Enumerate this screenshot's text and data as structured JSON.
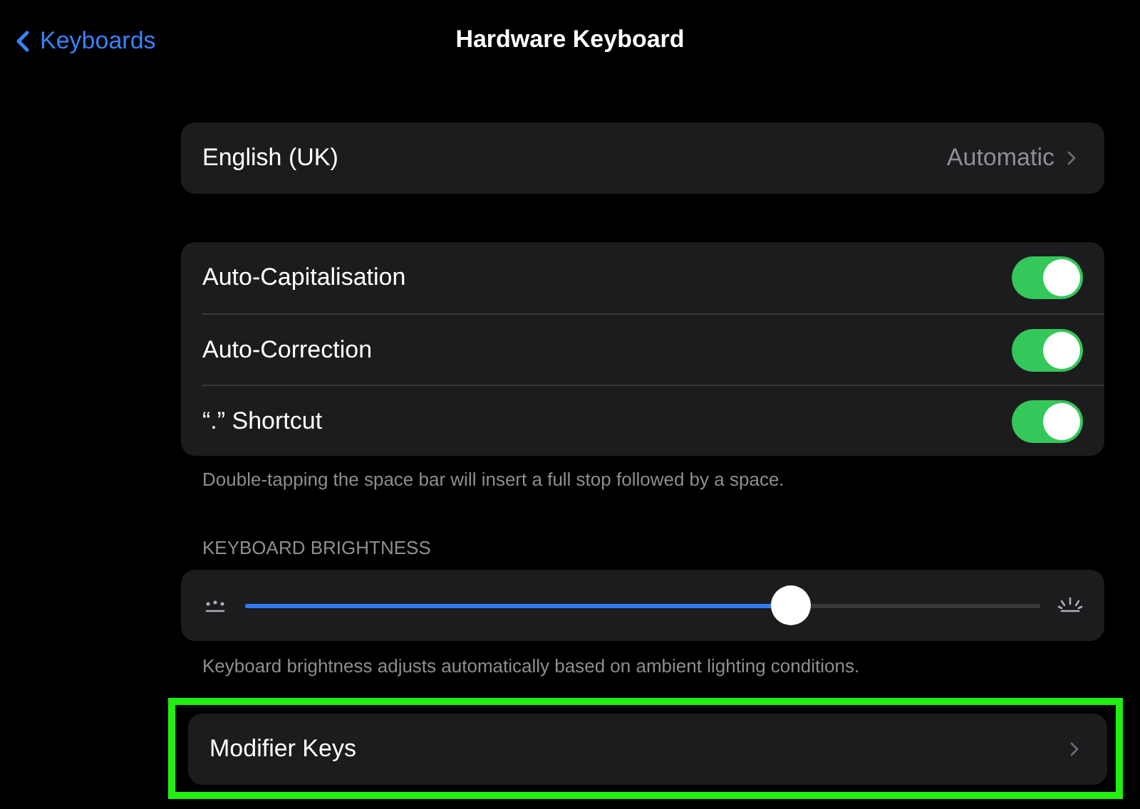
{
  "nav": {
    "back": "Keyboards",
    "title": "Hardware Keyboard"
  },
  "language": {
    "label": "English (UK)",
    "value": "Automatic"
  },
  "toggles": [
    {
      "label": "Auto-Capitalisation",
      "on": true
    },
    {
      "label": "Auto-Correction",
      "on": true
    },
    {
      "label": "“.” Shortcut",
      "on": true
    }
  ],
  "toggles_footer": "Double-tapping the space bar will insert a full stop followed by a space.",
  "brightness": {
    "header": "KEYBOARD BRIGHTNESS",
    "level": 0.686,
    "footer": "Keyboard brightness adjusts automatically based on ambient lighting conditions."
  },
  "modifier": {
    "label": "Modifier Keys",
    "highlighted": true
  }
}
